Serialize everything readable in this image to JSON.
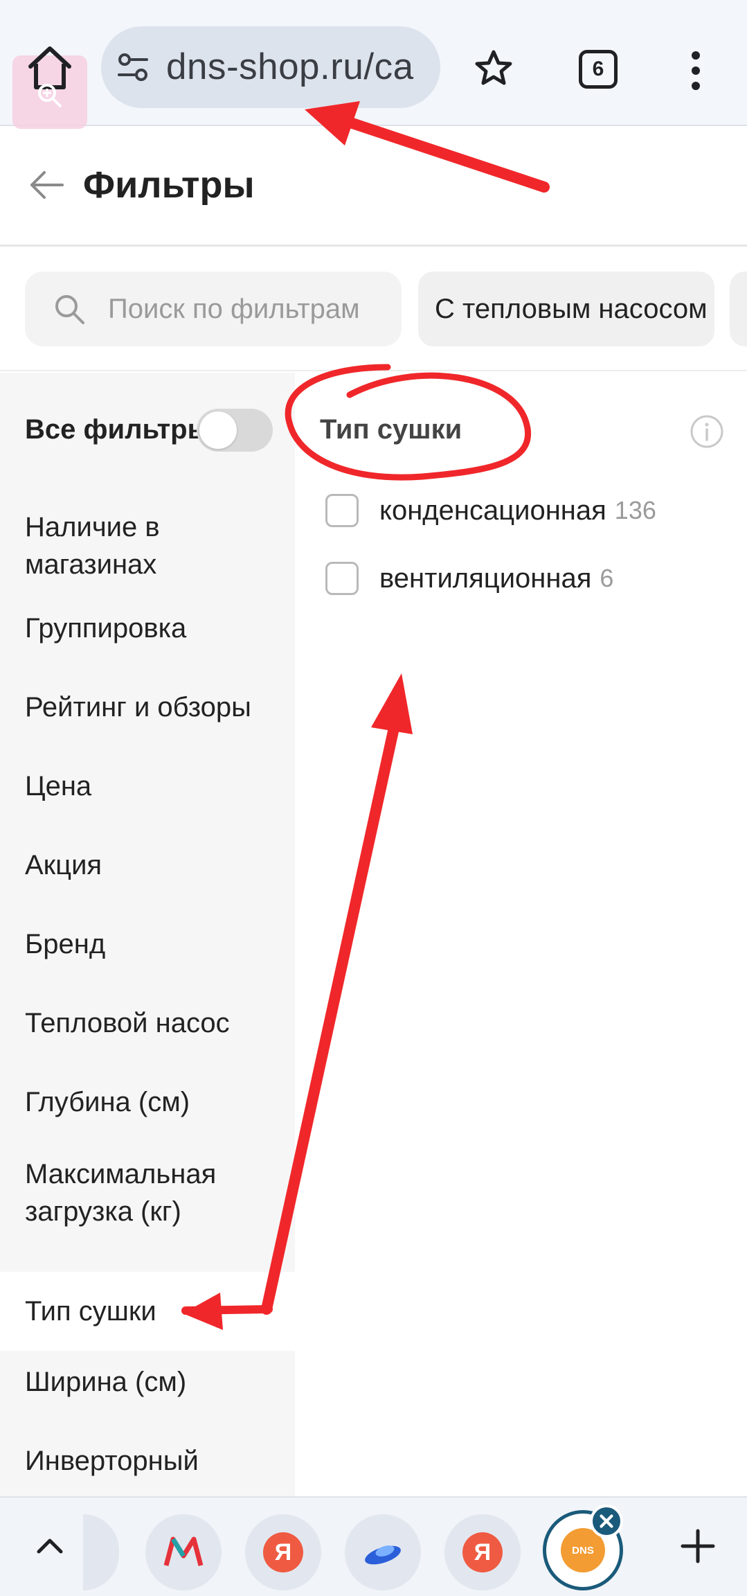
{
  "browser": {
    "url": "dns-shop.ru/ca",
    "tab_count": "6"
  },
  "header": {
    "title": "Фильтры"
  },
  "search": {
    "placeholder": "Поиск по фильтрам"
  },
  "chips": [
    {
      "label": "С тепловым насосом"
    }
  ],
  "sidebar": {
    "all_filters_label": "Все фильтры",
    "all_filters_enabled": false,
    "items": [
      {
        "label": "Наличие в магазинах",
        "active": false
      },
      {
        "label": "Группировка",
        "active": false
      },
      {
        "label": "Рейтинг и обзоры",
        "active": false
      },
      {
        "label": "Цена",
        "active": false
      },
      {
        "label": "Акция",
        "active": false
      },
      {
        "label": "Бренд",
        "active": false
      },
      {
        "label": "Тепловой насос",
        "active": false
      },
      {
        "label": "Глубина (см)",
        "active": false
      },
      {
        "label": "Максимальная загрузка (кг)",
        "active": false
      },
      {
        "label": "Тип сушки",
        "active": true
      },
      {
        "label": "Ширина (см)",
        "active": false
      },
      {
        "label": "Инверторный",
        "active": false
      }
    ]
  },
  "content": {
    "section_title": "Тип сушки",
    "options": [
      {
        "label": "конденсационная",
        "count": "136",
        "checked": false
      },
      {
        "label": "вентиляционная",
        "count": "6",
        "checked": false
      }
    ]
  },
  "bottom_tabs": {
    "ya_letter": "Я",
    "dns_label": "DNS"
  },
  "colors": {
    "annotation_red": "#f0272a",
    "accent_dark": "#1a5a7a",
    "dns_orange": "#f39c33"
  }
}
